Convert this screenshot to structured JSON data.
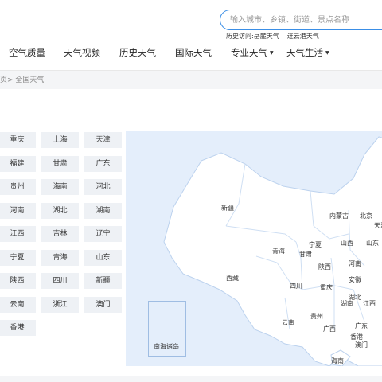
{
  "search": {
    "placeholder": "输入城市、乡镇、街道、景点名称"
  },
  "history": {
    "label": "历史访问:",
    "items": [
      "岳麓天气",
      "连云港天气"
    ]
  },
  "nav": {
    "items": [
      {
        "label": "空气质量",
        "caret": ""
      },
      {
        "label": "天气视频",
        "caret": ""
      },
      {
        "label": "历史天气",
        "caret": ""
      },
      {
        "label": "国际天气",
        "caret": ""
      },
      {
        "label": "专业天气",
        "caret": "▼"
      },
      {
        "label": "天气生活",
        "caret": "▼"
      }
    ]
  },
  "breadcrumb": {
    "prefix": "页>",
    "current": "全国天气"
  },
  "provinces": [
    "重庆",
    "上海",
    "天津",
    "福建",
    "甘肃",
    "广东",
    "贵州",
    "海南",
    "河北",
    "河南",
    "湖北",
    "湖南",
    "江西",
    "吉林",
    "辽宁",
    "宁夏",
    "青海",
    "山东",
    "陕西",
    "四川",
    "新疆",
    "云南",
    "浙江",
    "澳门",
    "香港"
  ],
  "map": {
    "inset_label": "南海诸岛",
    "labels": [
      "新疆",
      "内蒙古",
      "北京",
      "天津",
      "宁夏",
      "山西",
      "山东",
      "青海",
      "甘肃",
      "陕西",
      "河南",
      "西藏",
      "四川",
      "重庆",
      "安徽",
      "湖北",
      "湖南",
      "江西",
      "云南",
      "贵州",
      "广西",
      "广东",
      "香港",
      "澳门",
      "海南"
    ]
  }
}
